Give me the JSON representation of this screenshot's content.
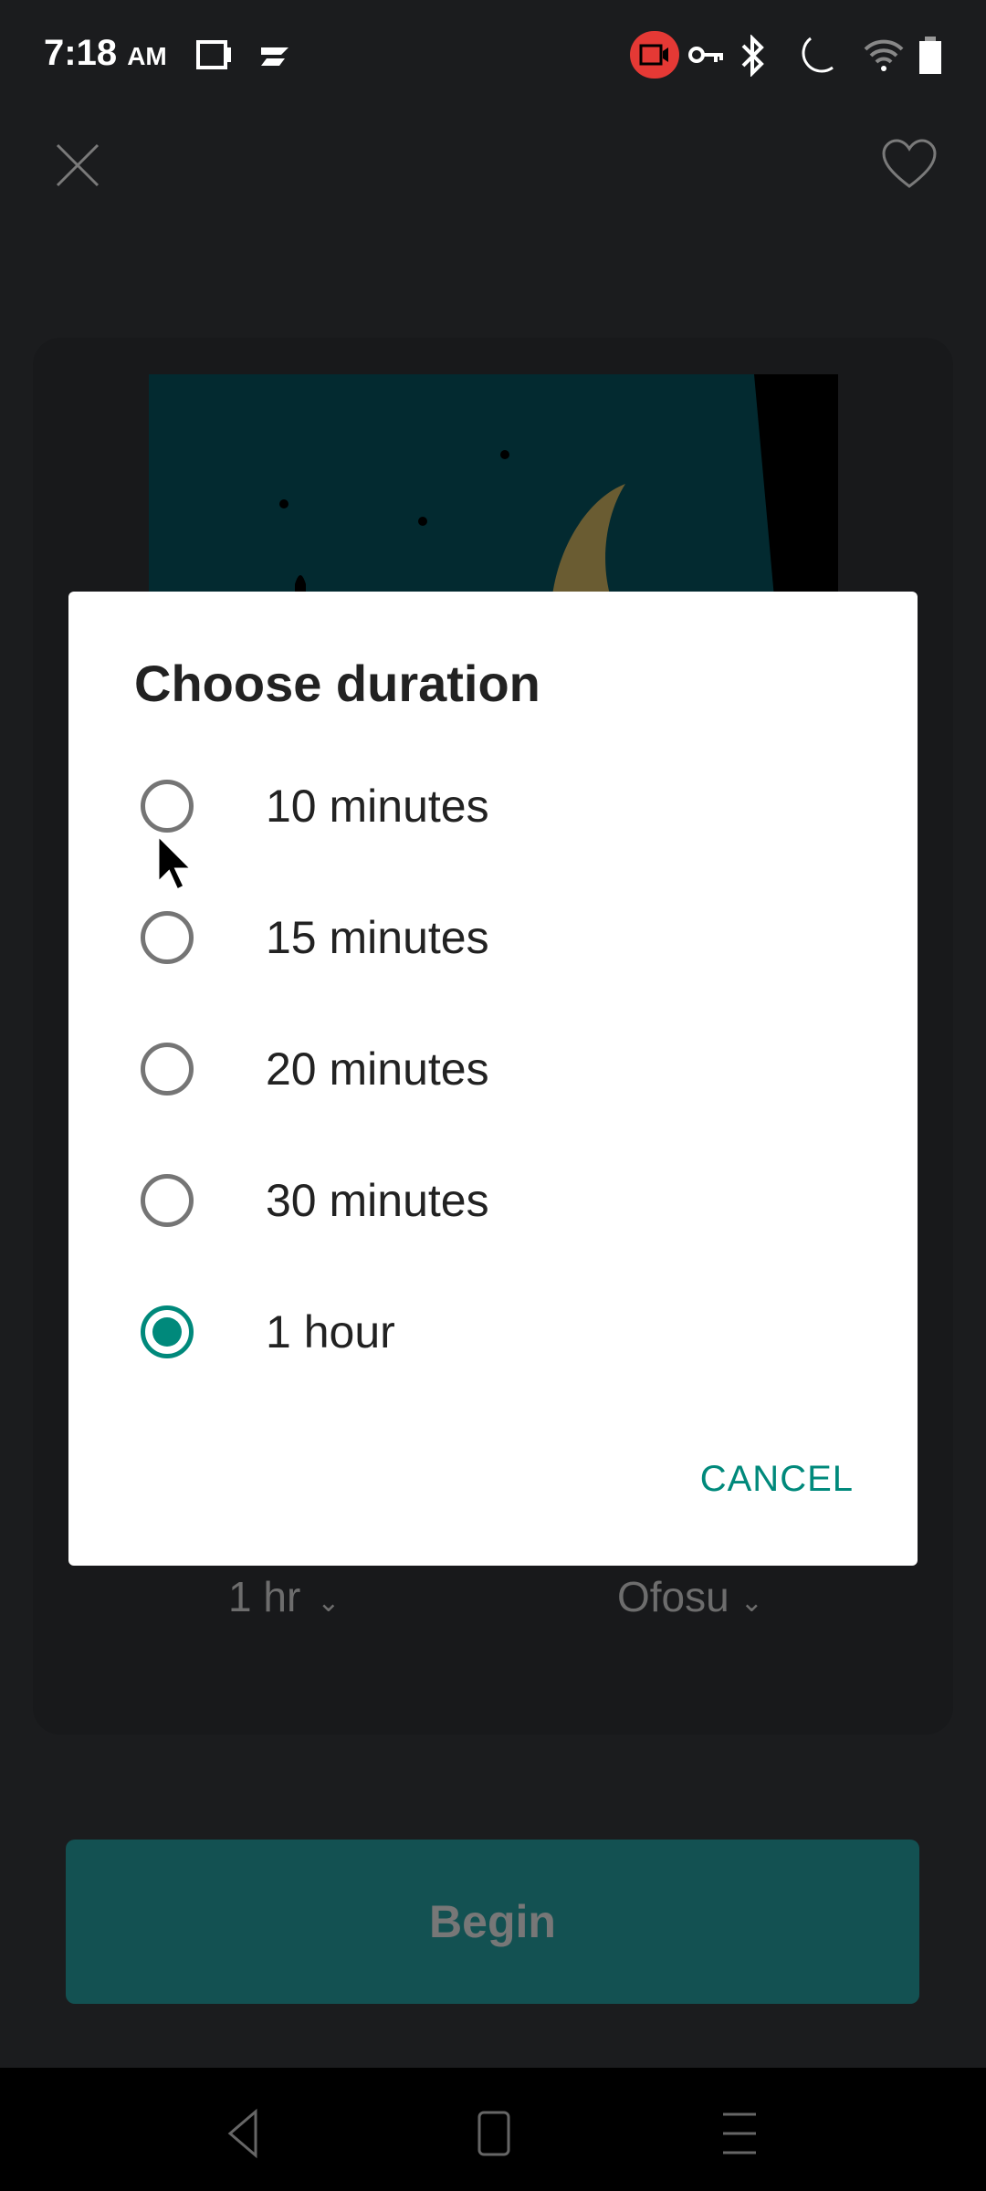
{
  "status_bar": {
    "time": "7:18",
    "ampm": "AM",
    "icons": [
      "screen-record-icon",
      "sync-check-icon",
      "recording-icon",
      "vpn-key-icon",
      "bluetooth-icon",
      "do-not-disturb-moon-icon",
      "wifi-icon",
      "battery-icon"
    ],
    "recording_color": "#e53935"
  },
  "header": {
    "close_icon": "close-icon",
    "favorite_icon": "heart-icon"
  },
  "dialog": {
    "title": "Choose duration",
    "options": [
      {
        "label": "10 minutes",
        "selected": false
      },
      {
        "label": "15 minutes",
        "selected": false
      },
      {
        "label": "20 minutes",
        "selected": false
      },
      {
        "label": "30 minutes",
        "selected": false
      },
      {
        "label": "1 hour",
        "selected": true
      }
    ],
    "cancel_label": "CANCEL",
    "accent": "#00897b"
  },
  "selectors": {
    "duration": "1 hr",
    "voice": "Ofosu"
  },
  "begin_label": "Begin"
}
